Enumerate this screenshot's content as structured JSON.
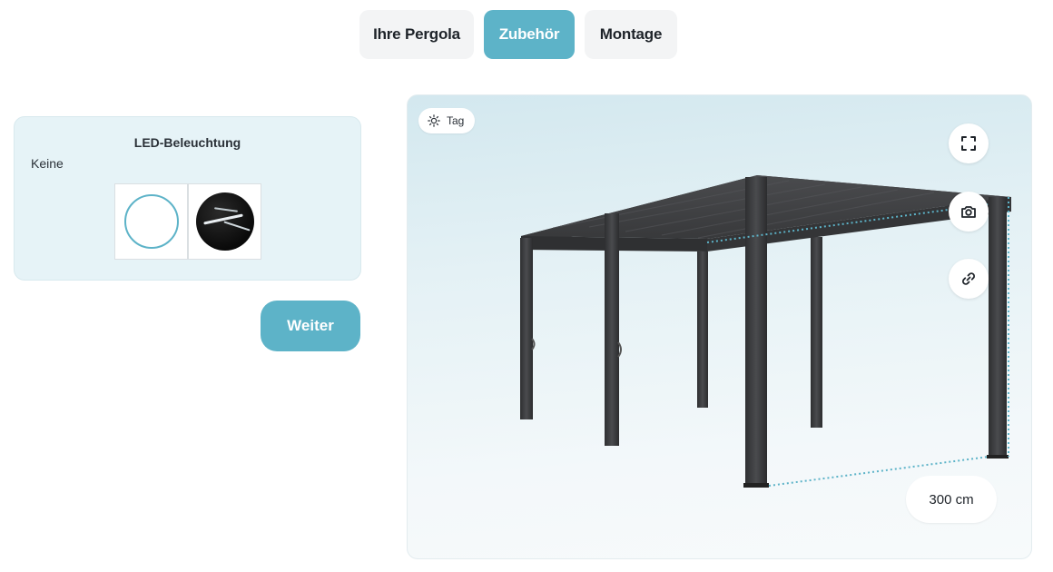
{
  "tabs": [
    {
      "label": "Ihre Pergola",
      "active": false
    },
    {
      "label": "Zubehör",
      "active": true
    },
    {
      "label": "Montage",
      "active": false
    }
  ],
  "led": {
    "title": "LED-Beleuchtung",
    "selected_value": "Keine",
    "options": [
      {
        "icon": "no-led-option-icon"
      },
      {
        "icon": "led-light-option-icon"
      }
    ]
  },
  "next_button": {
    "label": "Weiter"
  },
  "viewer": {
    "light_mode_label": "Tag",
    "light_mode_icon": "sun-icon",
    "controls": [
      {
        "icon": "fullscreen-icon"
      },
      {
        "icon": "camera-icon"
      },
      {
        "icon": "link-icon"
      }
    ],
    "dimension_label": "300 cm"
  },
  "colors": {
    "accent": "#5db3c8",
    "frame": "#3a3b3d",
    "panel_bg": "#e6f3f7"
  }
}
